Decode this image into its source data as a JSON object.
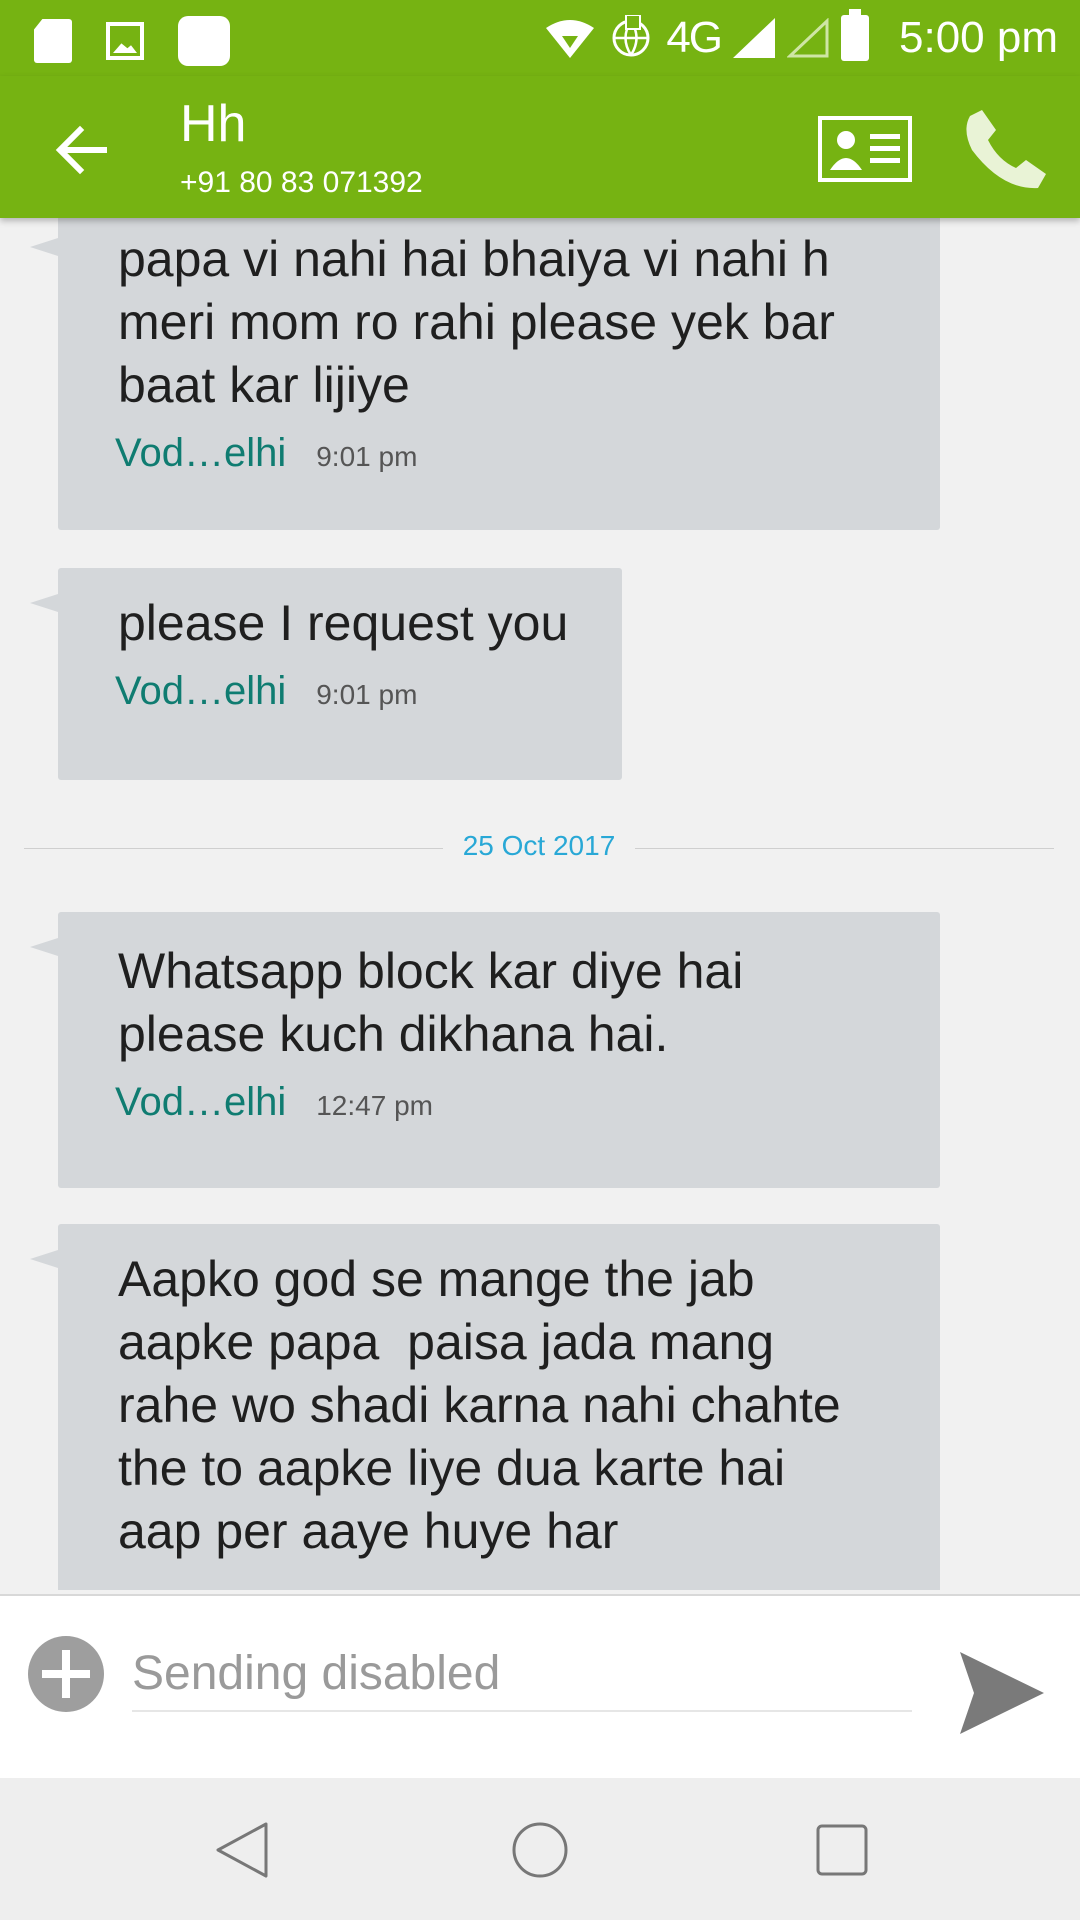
{
  "status_bar": {
    "network": "4G",
    "time": "5:00 pm",
    "icons": [
      "sd-card-icon",
      "image-icon",
      "app-notification-icon",
      "wifi-icon",
      "globe-icon",
      "signal-icon",
      "signal-empty-icon",
      "battery-icon"
    ]
  },
  "header": {
    "contact_name": "Hh",
    "contact_number": "+91 80 83 071392",
    "icons": [
      "back-arrow-icon",
      "contact-card-icon",
      "phone-icon"
    ]
  },
  "messages": [
    {
      "text": "papa vi nahi hai bhaiya vi nahi h\nmeri mom ro rahi please yek bar\nbaat kar lijiye",
      "sim": "Vod…elhi",
      "time": "9:01 pm"
    },
    {
      "text": "please I request you",
      "sim": "Vod…elhi",
      "time": "9:01 pm"
    },
    {
      "text": "Whatsapp block kar diye hai\nplease kuch dikhana hai.",
      "sim": "Vod…elhi",
      "time": "12:47 pm"
    },
    {
      "text": "Aapko god se mange the jab\naapke papa  paisa jada mang\nrahe wo shadi karna nahi chahte\nthe to aapke liye dua karte hai\naap per aaye huye har",
      "sim": "",
      "time": ""
    }
  ],
  "date_divider": "25 Oct 2017",
  "compose": {
    "placeholder": "Sending disabled"
  },
  "colors": {
    "brand_green": "#76b312",
    "bubble": "#d4d7da",
    "sim_label": "#0f7c71",
    "date_label": "#29a8d6"
  }
}
